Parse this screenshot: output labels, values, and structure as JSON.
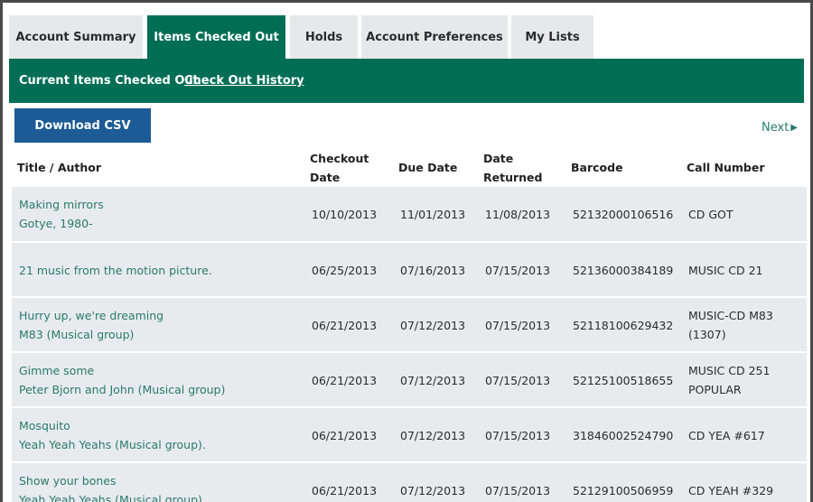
{
  "tabs": [
    {
      "label": "Account Summary",
      "active": false
    },
    {
      "label": "Items Checked Out",
      "active": true
    },
    {
      "label": "Holds",
      "active": false
    },
    {
      "label": "Account Preferences",
      "active": false
    },
    {
      "label": "My Lists",
      "active": false
    }
  ],
  "subnav": {
    "current_label": "Current Items Checked Out",
    "history_label": "Check Out History"
  },
  "toolbar": {
    "download_label": "Download CSV",
    "next_label": "Next",
    "next_icon": "triangle-right-icon"
  },
  "table": {
    "headers": {
      "title_author": "Title / Author",
      "checkout_line1": "Checkout",
      "checkout_line2": "Date",
      "due": "Due Date",
      "returned_line1": "Date",
      "returned_line2": "Returned",
      "barcode": "Barcode",
      "call_number": "Call Number"
    },
    "rows": [
      {
        "title": "Making mirrors",
        "author": "Gotye, 1980-",
        "checkout": "10/10/2013",
        "due": "11/01/2013",
        "returned": "11/08/2013",
        "barcode": "52132000106516",
        "call1": "CD GOT",
        "call2": ""
      },
      {
        "title": "21 music from the motion picture.",
        "author": "",
        "checkout": "06/25/2013",
        "due": "07/16/2013",
        "returned": "07/15/2013",
        "barcode": "52136000384189",
        "call1": "MUSIC CD 21",
        "call2": ""
      },
      {
        "title": "Hurry up, we're dreaming",
        "author": "M83 (Musical group)",
        "checkout": "06/21/2013",
        "due": "07/12/2013",
        "returned": "07/15/2013",
        "barcode": "52118100629432",
        "call1": "MUSIC-CD M83",
        "call2": "(1307)"
      },
      {
        "title": "Gimme some",
        "author": "Peter Bjorn and John (Musical group)",
        "checkout": "06/21/2013",
        "due": "07/12/2013",
        "returned": "07/15/2013",
        "barcode": "52125100518655",
        "call1": "MUSIC CD 251",
        "call2": "POPULAR"
      },
      {
        "title": "Mosquito",
        "author": "Yeah Yeah Yeahs (Musical group).",
        "checkout": "06/21/2013",
        "due": "07/12/2013",
        "returned": "07/15/2013",
        "barcode": "31846002524790",
        "call1": "CD YEA #617",
        "call2": ""
      },
      {
        "title": "Show your bones",
        "author": "Yeah Yeah Yeahs (Musical group)",
        "checkout": "06/21/2013",
        "due": "07/12/2013",
        "returned": "07/15/2013",
        "barcode": "52129100506959",
        "call1": "CD YEAH #329",
        "call2": ""
      }
    ]
  },
  "colors": {
    "brand_green": "#006e55",
    "button_blue": "#1d5b96",
    "link_teal": "#2a7a6a",
    "row_bg": "#e8ebed"
  }
}
